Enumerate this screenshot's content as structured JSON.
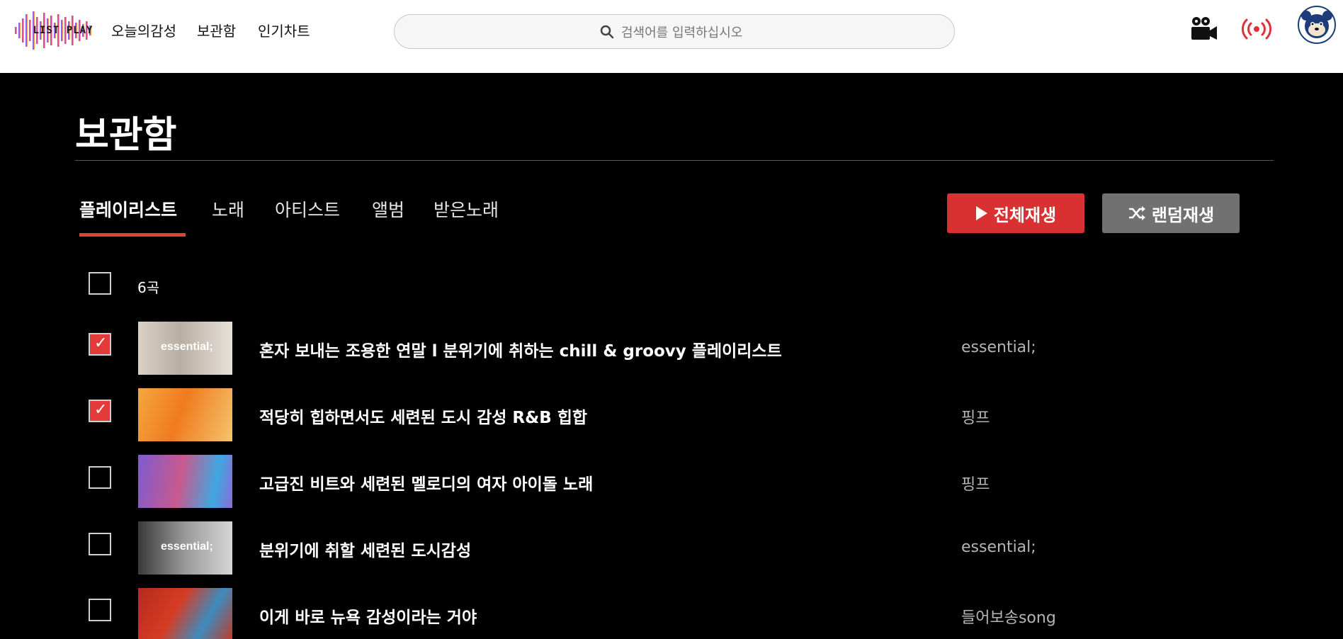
{
  "header": {
    "logo_text": "LIST PLAY",
    "nav": [
      "오늘의감성",
      "보관함",
      "인기차트"
    ],
    "search": {
      "placeholder": "검색어를 입력하십시오"
    },
    "icons": [
      "camera-icon",
      "broadcast-icon",
      "profile-avatar"
    ]
  },
  "page": {
    "title": "보관함",
    "tabs": [
      {
        "label": "플레이리스트",
        "active": true
      },
      {
        "label": "노래",
        "active": false
      },
      {
        "label": "아티스트",
        "active": false
      },
      {
        "label": "앨범",
        "active": false
      },
      {
        "label": "받은노래",
        "active": false
      }
    ],
    "buttons": {
      "play_all": "전체재생",
      "shuffle": "랜덤재생"
    },
    "count": "6곡",
    "select_all_checked": false,
    "rows": [
      {
        "title": "혼자 보내는 조용한 연말 l 분위기에 취하는 chill & groovy 플레이리스트",
        "artist": "essential;",
        "checked": true,
        "thumb_label": "essential;"
      },
      {
        "title": "적당히 힙하면서도 세련된 도시 감성 R&B 힙합",
        "artist": "핑프",
        "checked": true,
        "thumb_label": ""
      },
      {
        "title": "고급진 비트와 세련된 멜로디의 여자 아이돌 노래",
        "artist": "핑프",
        "checked": false,
        "thumb_label": ""
      },
      {
        "title": "분위기에 취할 세련된 도시감성",
        "artist": "essential;",
        "checked": false,
        "thumb_label": "essential;"
      },
      {
        "title": "이게 바로 뉴욕 감성이라는 거야",
        "artist": "들어보송song",
        "checked": false,
        "thumb_label": ""
      }
    ]
  },
  "colors": {
    "accent": "#d93131",
    "shuffle": "#717171",
    "underline": "#e1422e"
  }
}
